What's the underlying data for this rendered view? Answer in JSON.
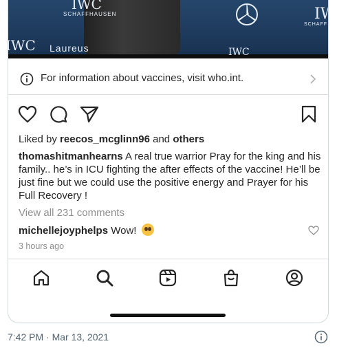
{
  "photo": {
    "logos": {
      "iwc_top": "IWC",
      "schaffhausen_top": "SCHAFFHAUSEN",
      "iwc_left": "IWC",
      "laureus": "Laureus",
      "iwc_bottom": "IWC",
      "iwc_right": "IW",
      "schaffhausen_right": "SCHAFF"
    }
  },
  "info_bar": {
    "text": "For information about vaccines, visit who.int.",
    "icon": "info-icon",
    "chevron": "chevron-right-icon"
  },
  "actions": {
    "icons": [
      "heart-icon",
      "comment-icon",
      "share-icon",
      "bookmark-icon"
    ]
  },
  "likes": {
    "prefix": "Liked by ",
    "user": "reecos_mcglinn96",
    "middle": " and ",
    "others": "others"
  },
  "caption": {
    "username": "thomashitmanhearns",
    "text": " A real true warrior Pray for the king and his family.. he’s in ICU fighting the after effects of the vaccine! He’ll be just fine but we could use the positive energy and Prayer for his Full Recovery !"
  },
  "comments": {
    "view_all": "View all 231 comments",
    "comment_user": "michellejoyphelps",
    "comment_text": " Wow! ",
    "comment_emoji": "pleading-face-emoji",
    "time_ago": "3 hours ago"
  },
  "navbar": {
    "items": [
      "home-icon",
      "search-icon",
      "reels-icon",
      "shop-icon",
      "profile-icon"
    ]
  },
  "tweet": {
    "timestamp": "7:42 PM · Mar 13, 2021"
  },
  "colors": {
    "text": "#262626",
    "muted": "#8e8e8e",
    "tweet_meta": "#536471",
    "border": "#dbdbdb"
  }
}
